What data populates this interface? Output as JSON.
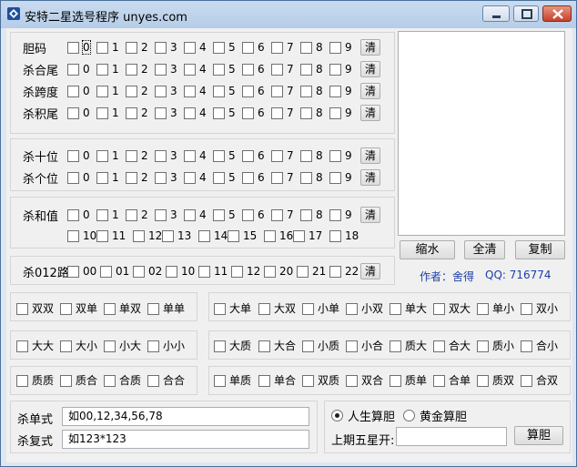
{
  "window": {
    "title": "安特二星选号程序 unyes.com",
    "minimize": "minimize",
    "maximize": "maximize",
    "close": "close"
  },
  "digits": [
    "0",
    "1",
    "2",
    "3",
    "4",
    "5",
    "6",
    "7",
    "8",
    "9"
  ],
  "sums": [
    "10",
    "11",
    "12",
    "13",
    "14",
    "15",
    "16",
    "17",
    "18"
  ],
  "routes": [
    "00",
    "01",
    "02",
    "10",
    "11",
    "12",
    "20",
    "21",
    "22"
  ],
  "rows": {
    "dan": "胆码",
    "hewei": "杀合尾",
    "kuadu": "杀跨度",
    "jiwei": "杀积尾",
    "shiwei": "杀十位",
    "gewei": "杀个位",
    "hezhi": "杀和值",
    "lu012": "杀012路"
  },
  "clear_label": "清",
  "pattern_groups": {
    "g1": [
      "双双",
      "双单",
      "单双",
      "单单"
    ],
    "g2": [
      "大单",
      "大双",
      "小单",
      "小双",
      "单大",
      "双大",
      "单小",
      "双小"
    ],
    "g3": [
      "大大",
      "大小",
      "小大",
      "小小"
    ],
    "g4": [
      "大质",
      "大合",
      "小质",
      "小合",
      "质大",
      "合大",
      "质小",
      "合小"
    ],
    "g5": [
      "质质",
      "质合",
      "合质",
      "合合"
    ],
    "g6": [
      "单质",
      "单合",
      "双质",
      "双合",
      "质单",
      "合单",
      "质双",
      "合双"
    ]
  },
  "buttons": {
    "shrink": "缩水",
    "select_all": "全清",
    "copy": "复制",
    "calc": "算胆"
  },
  "author": {
    "author_label": "作者：舍得",
    "qq": "QQ: 716774"
  },
  "kill": {
    "single_label": "杀单式",
    "single_value": "如00,12,34,56,78",
    "multi_label": "杀复式",
    "multi_value": "如123*123"
  },
  "calc": {
    "radio_life": "人生算胆",
    "radio_gold": "黄金算胆",
    "prev_label": "上期五星开:",
    "prev_value": ""
  }
}
